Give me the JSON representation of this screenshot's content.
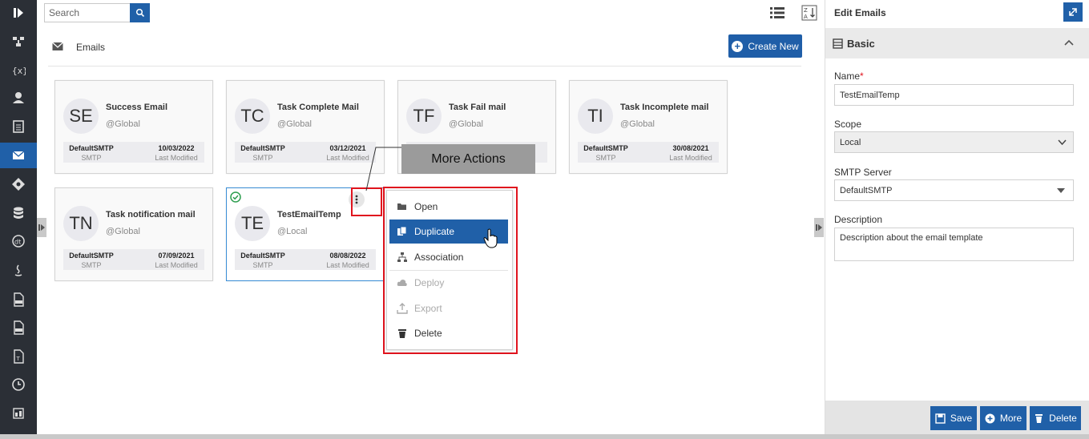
{
  "search": {
    "placeholder": "Search"
  },
  "header": {
    "title": "Emails",
    "create_label": "Create New"
  },
  "cards": [
    {
      "initials": "SE",
      "title": "Success Email",
      "scope": "@Global",
      "server": "DefaultSMTP",
      "server_type": "SMTP",
      "date": "10/03/2022",
      "date_label": "Last Modified"
    },
    {
      "initials": "TC",
      "title": "Task Complete Mail",
      "scope": "@Global",
      "server": "DefaultSMTP",
      "server_type": "SMTP",
      "date": "03/12/2021",
      "date_label": "Last Modified"
    },
    {
      "initials": "TF",
      "title": "Task Fail mail",
      "scope": "@Global",
      "server": "",
      "server_type": "",
      "date": "",
      "date_label": ""
    },
    {
      "initials": "TI",
      "title": "Task Incomplete mail",
      "scope": "@Global",
      "server": "DefaultSMTP",
      "server_type": "SMTP",
      "date": "30/08/2021",
      "date_label": "Last Modified"
    },
    {
      "initials": "TN",
      "title": "Task notification mail",
      "scope": "@Global",
      "server": "DefaultSMTP",
      "server_type": "SMTP",
      "date": "07/09/2021",
      "date_label": "Last Modified"
    },
    {
      "initials": "TE",
      "title": "TestEmailTemp",
      "scope": "@Local",
      "server": "DefaultSMTP",
      "server_type": "SMTP",
      "date": "08/08/2022",
      "date_label": "Last Modified"
    }
  ],
  "tooltip": "More Actions",
  "menu": {
    "open": "Open",
    "duplicate": "Duplicate",
    "association": "Association",
    "deploy": "Deploy",
    "export": "Export",
    "delete": "Delete"
  },
  "panel": {
    "title": "Edit Emails",
    "section": "Basic",
    "name_label": "Name",
    "name_required": "*",
    "name_value": "TestEmailTemp",
    "scope_label": "Scope",
    "scope_value": "Local",
    "smtp_label": "SMTP Server",
    "smtp_value": "DefaultSMTP",
    "desc_label": "Description",
    "desc_value": "Description about the email template",
    "save_label": "Save",
    "more_label": "More",
    "delete_label": "Delete"
  },
  "colors": {
    "accent": "#2060a8",
    "highlight": "#e0141e",
    "rail": "#2b2f36"
  }
}
